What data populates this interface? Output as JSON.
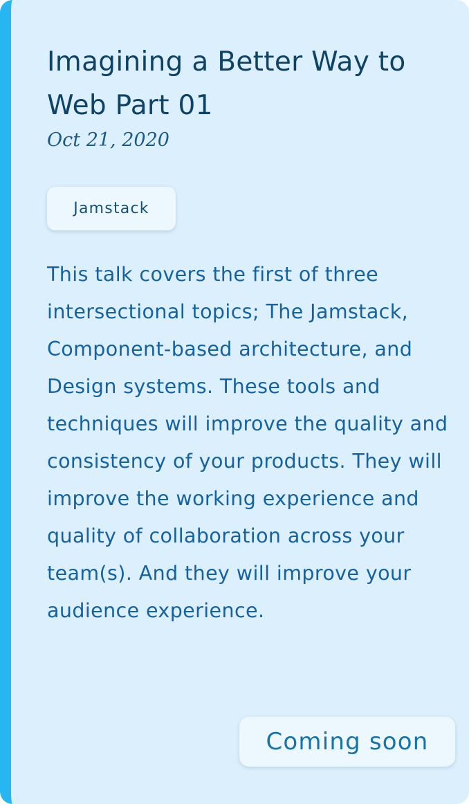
{
  "card": {
    "title": "Imagining a Better Way to Web Part 01",
    "date": "Oct 21, 2020",
    "tag": "Jamstack",
    "description": "This talk covers the first of three intersectional topics; The Jamstack, Component-based architecture, and Design systems. These tools and techniques will improve the quality and consistency of your products. They will improve the working experience and quality of collaboration across your team(s). And they will improve your audience experience.",
    "status_label": "Coming soon"
  },
  "colors": {
    "card_background": "#dbf0fc",
    "accent_border": "#27b6f2",
    "title_text": "#0f4366",
    "body_text": "#1662a0"
  }
}
